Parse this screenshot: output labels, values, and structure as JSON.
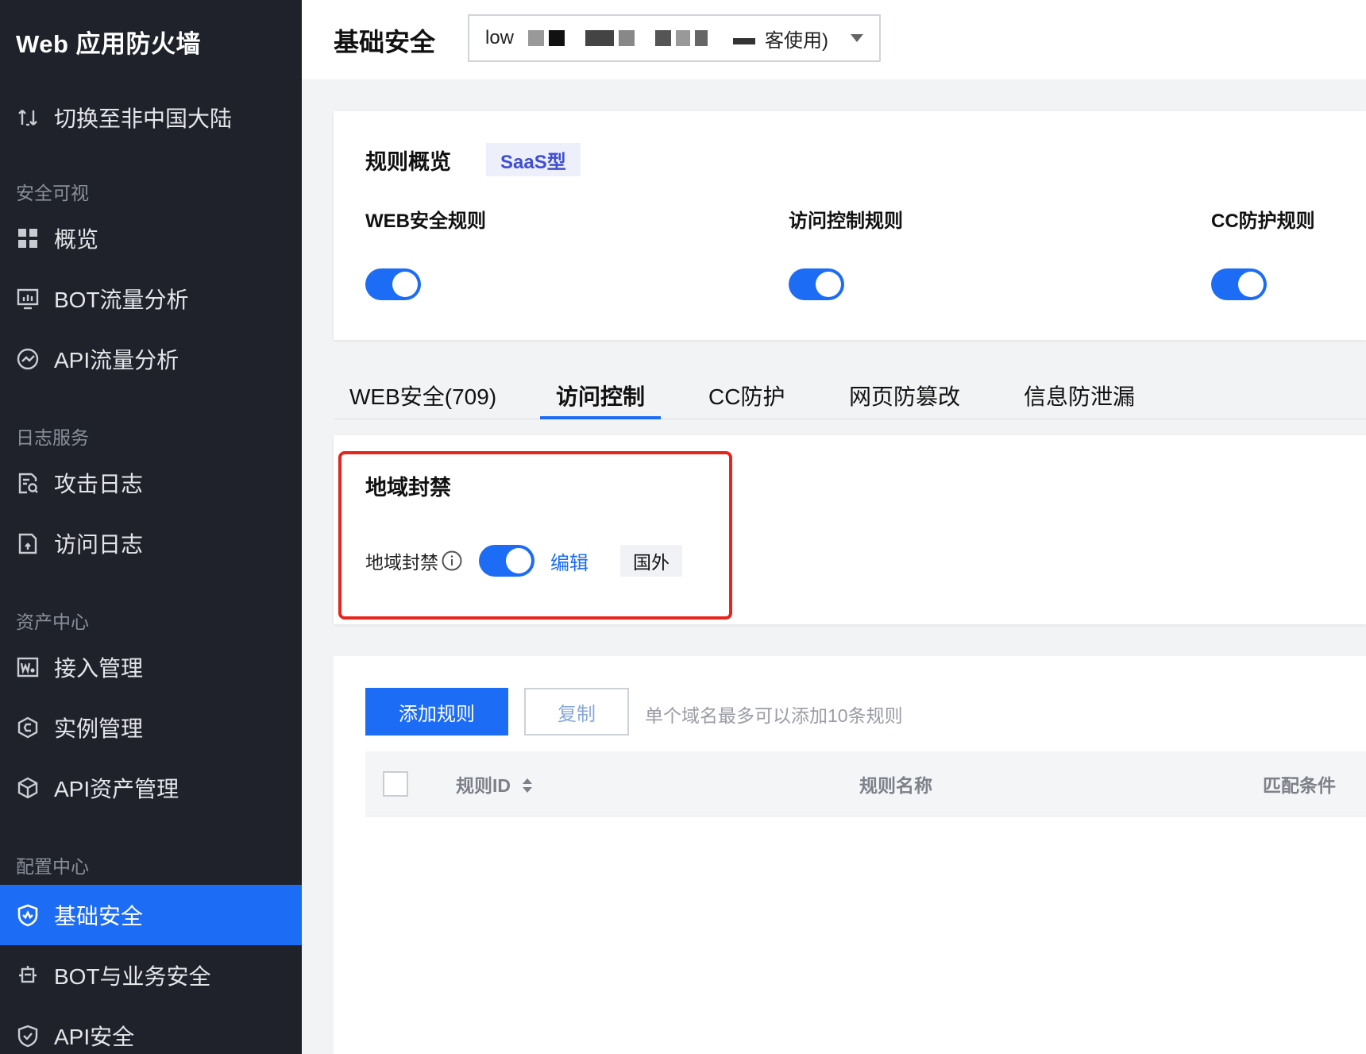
{
  "sidebar": {
    "brand": "Web 应用防火墙",
    "switch_region": "切换至非中国大陆",
    "groups": [
      {
        "title": "安全可视"
      },
      {
        "title": "日志服务"
      },
      {
        "title": "资产中心"
      },
      {
        "title": "配置中心"
      }
    ],
    "items": [
      {
        "label": "概览",
        "icon": "grid-icon"
      },
      {
        "label": "BOT流量分析",
        "icon": "monitor-chart-icon"
      },
      {
        "label": "API流量分析",
        "icon": "trend-circle-icon"
      },
      {
        "label": "攻击日志",
        "icon": "attack-log-icon"
      },
      {
        "label": "访问日志",
        "icon": "access-log-icon"
      },
      {
        "label": "接入管理",
        "icon": "web-access-icon"
      },
      {
        "label": "实例管理",
        "icon": "instance-icon"
      },
      {
        "label": "API资产管理",
        "icon": "cube-icon"
      },
      {
        "label": "基础安全",
        "icon": "shield-pulse-icon",
        "active": true
      },
      {
        "label": "BOT与业务安全",
        "icon": "bot-chip-icon"
      },
      {
        "label": "API安全",
        "icon": "shield-check-icon"
      }
    ]
  },
  "header": {
    "title": "基础安全",
    "instance_prefix": "low",
    "instance_suffix": "客使用)"
  },
  "overview": {
    "title": "规则概览",
    "badge": "SaaS型",
    "rules": [
      {
        "label": "WEB安全规则",
        "enabled": true
      },
      {
        "label": "访问控制规则",
        "enabled": true
      },
      {
        "label": "CC防护规则",
        "enabled": true
      }
    ]
  },
  "tabs": [
    {
      "label": "WEB安全(709)"
    },
    {
      "label": "访问控制",
      "active": true
    },
    {
      "label": "CC防护"
    },
    {
      "label": "网页防篡改"
    },
    {
      "label": "信息防泄漏"
    }
  ],
  "geo_block": {
    "title": "地域封禁",
    "label": "地域封禁",
    "enabled": true,
    "edit_label": "编辑",
    "region": "国外"
  },
  "rules_table": {
    "add_label": "添加规则",
    "copy_label": "复制",
    "hint": "单个域名最多可以添加10条规则",
    "columns": [
      "规则ID",
      "规则名称",
      "匹配条件"
    ]
  },
  "colors": {
    "primary": "#1c6cf5",
    "sidebar_bg": "#1f222b",
    "highlight": "#e8251c"
  }
}
